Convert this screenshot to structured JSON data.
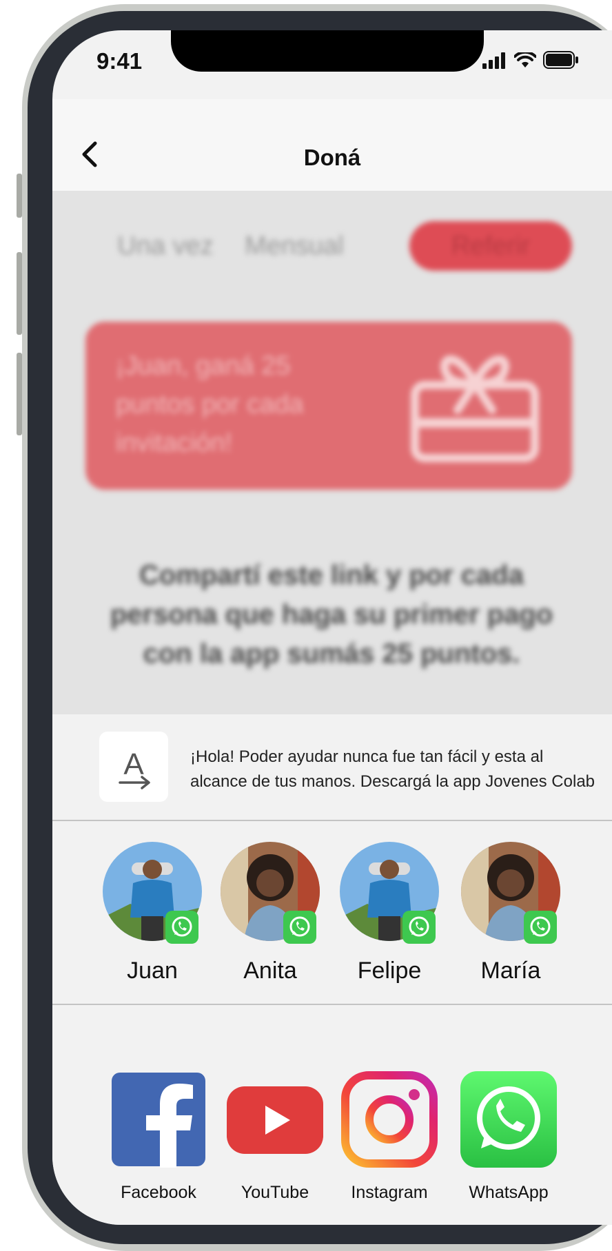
{
  "status_bar": {
    "time": "9:41"
  },
  "nav": {
    "title": "Doná"
  },
  "segments": [
    {
      "label": "Una vez",
      "active": false
    },
    {
      "label": "Mensual",
      "active": false
    },
    {
      "label": "Referir",
      "active": true
    }
  ],
  "promo": {
    "text": "¡Juan, ganá 25 puntos por cada invitación!"
  },
  "share_description": "Compartí este link y por cada persona que haga su primer pago con la app sumás 25 puntos.",
  "share_sheet": {
    "message": {
      "line1": "¡Hola! Poder ayudar nunca fue tan fácil y esta al",
      "line2": "alcance de tus manos. Descargá la app Jovenes Colab"
    },
    "contacts": [
      {
        "name": "Juan"
      },
      {
        "name": "Anita"
      },
      {
        "name": "Felipe"
      },
      {
        "name": "María"
      }
    ],
    "apps": [
      {
        "label": "Facebook",
        "icon": "facebook-icon"
      },
      {
        "label": "YouTube",
        "icon": "youtube-icon"
      },
      {
        "label": "Instagram",
        "icon": "instagram-icon"
      },
      {
        "label": "WhatsApp",
        "icon": "whatsapp-icon"
      }
    ]
  },
  "colors": {
    "accent": "#de4c55",
    "promo_card": "#e06d72",
    "whatsapp": "#3ec84f",
    "facebook": "#4267b2",
    "youtube": "#e03c3c"
  }
}
